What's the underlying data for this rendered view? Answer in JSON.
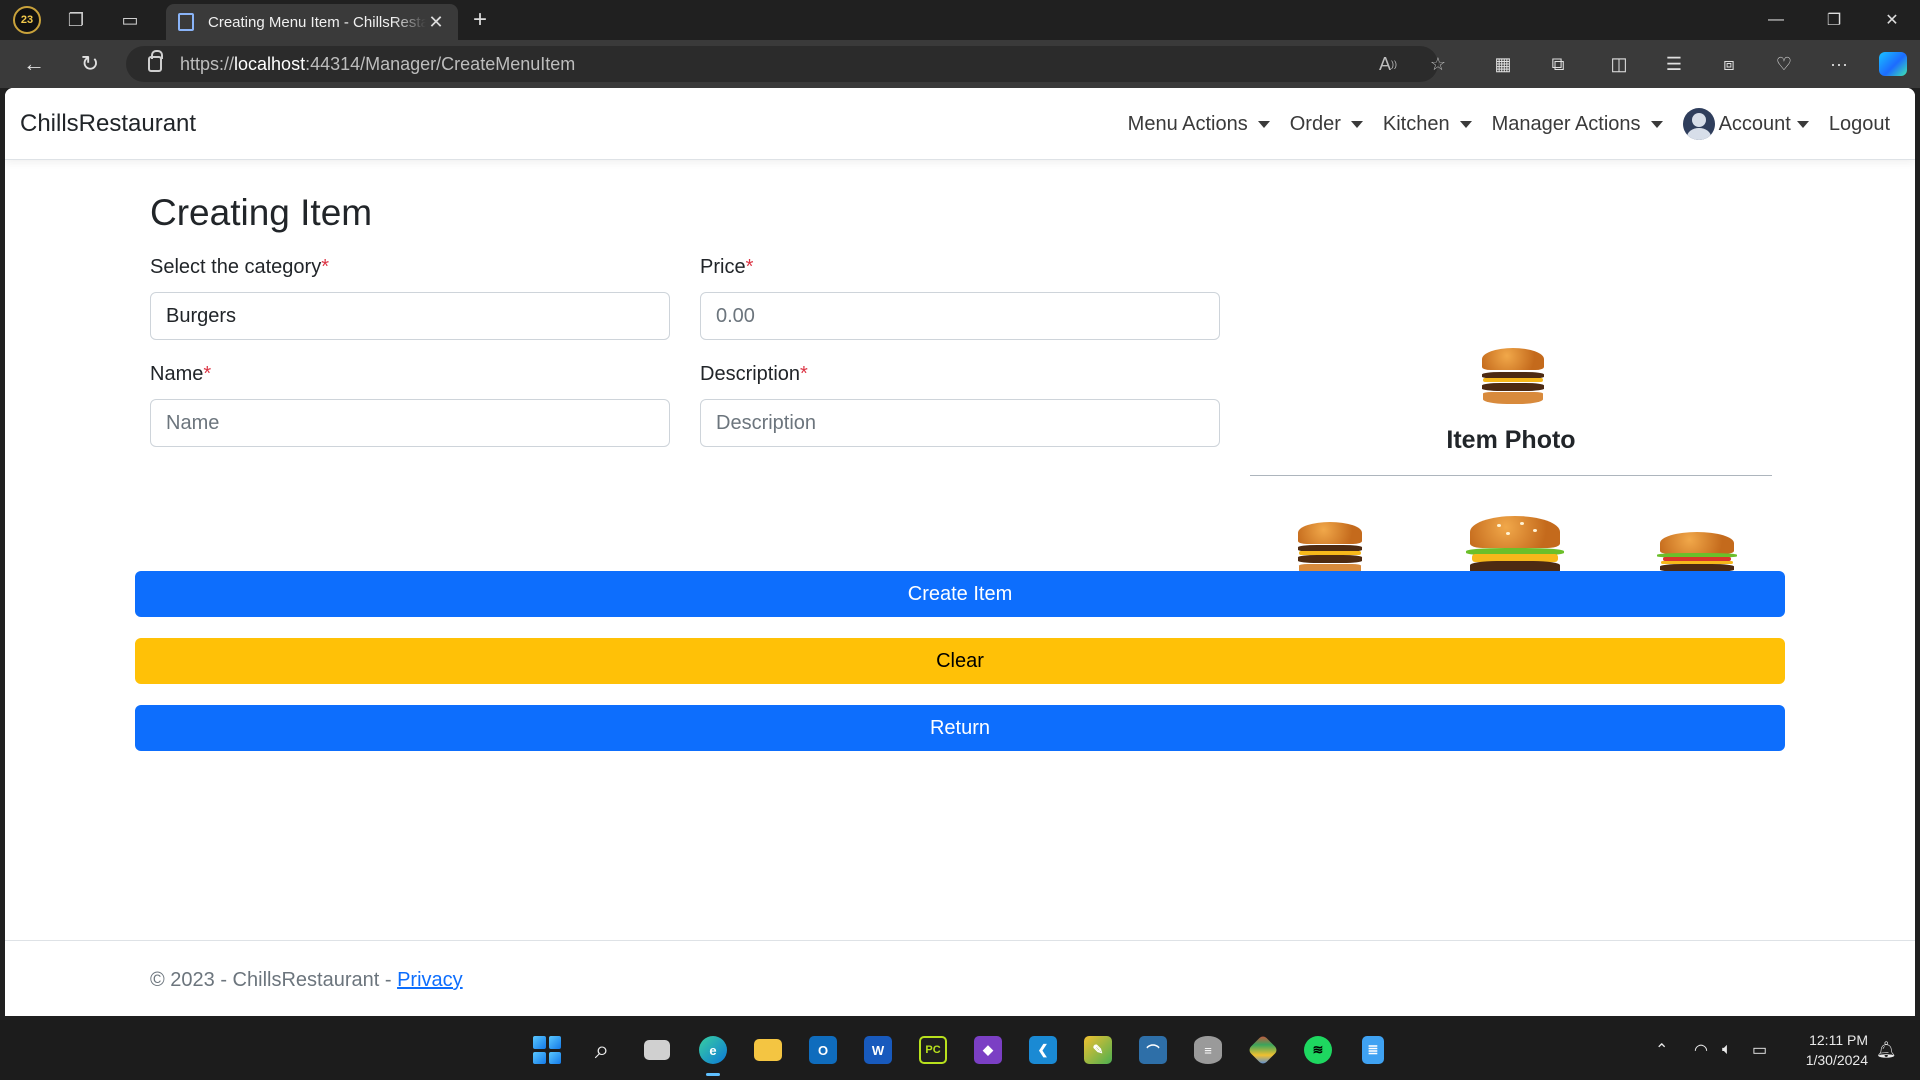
{
  "browser": {
    "tab_title": "Creating Menu Item - ChillsRestaurant",
    "profile_badge": "23",
    "url_scheme": "https://",
    "url_host": "localhost",
    "url_path": ":44314/Manager/CreateMenuItem"
  },
  "site": {
    "brand": "ChillsRestaurant",
    "nav": [
      "Menu Actions",
      "Order",
      "Kitchen",
      "Manager Actions"
    ],
    "account_label": "Account",
    "logout_label": "Logout"
  },
  "form": {
    "title": "Creating Item",
    "required_mark": "*",
    "category_label": "Select the category",
    "category_value": "Burgers",
    "price_label": "Price",
    "price_placeholder": "0.00",
    "name_label": "Name",
    "name_placeholder": "Name",
    "description_label": "Description",
    "description_placeholder": "Description"
  },
  "photo": {
    "title": "Item Photo",
    "selected_icon": "burger-photo-icon",
    "options": [
      "burger-photo-1",
      "burger-photo-2",
      "burger-photo-3"
    ]
  },
  "buttons": {
    "create": "Create Item",
    "clear": "Clear",
    "return": "Return"
  },
  "footer": {
    "text": "© 2023 - ChillsRestaurant - ",
    "privacy": "Privacy"
  },
  "taskbar": {
    "time": "12:11 PM",
    "date": "1/30/2024"
  },
  "colors": {
    "primary": "#0d6efd",
    "warning": "#ffc107",
    "required": "#dc3545"
  }
}
